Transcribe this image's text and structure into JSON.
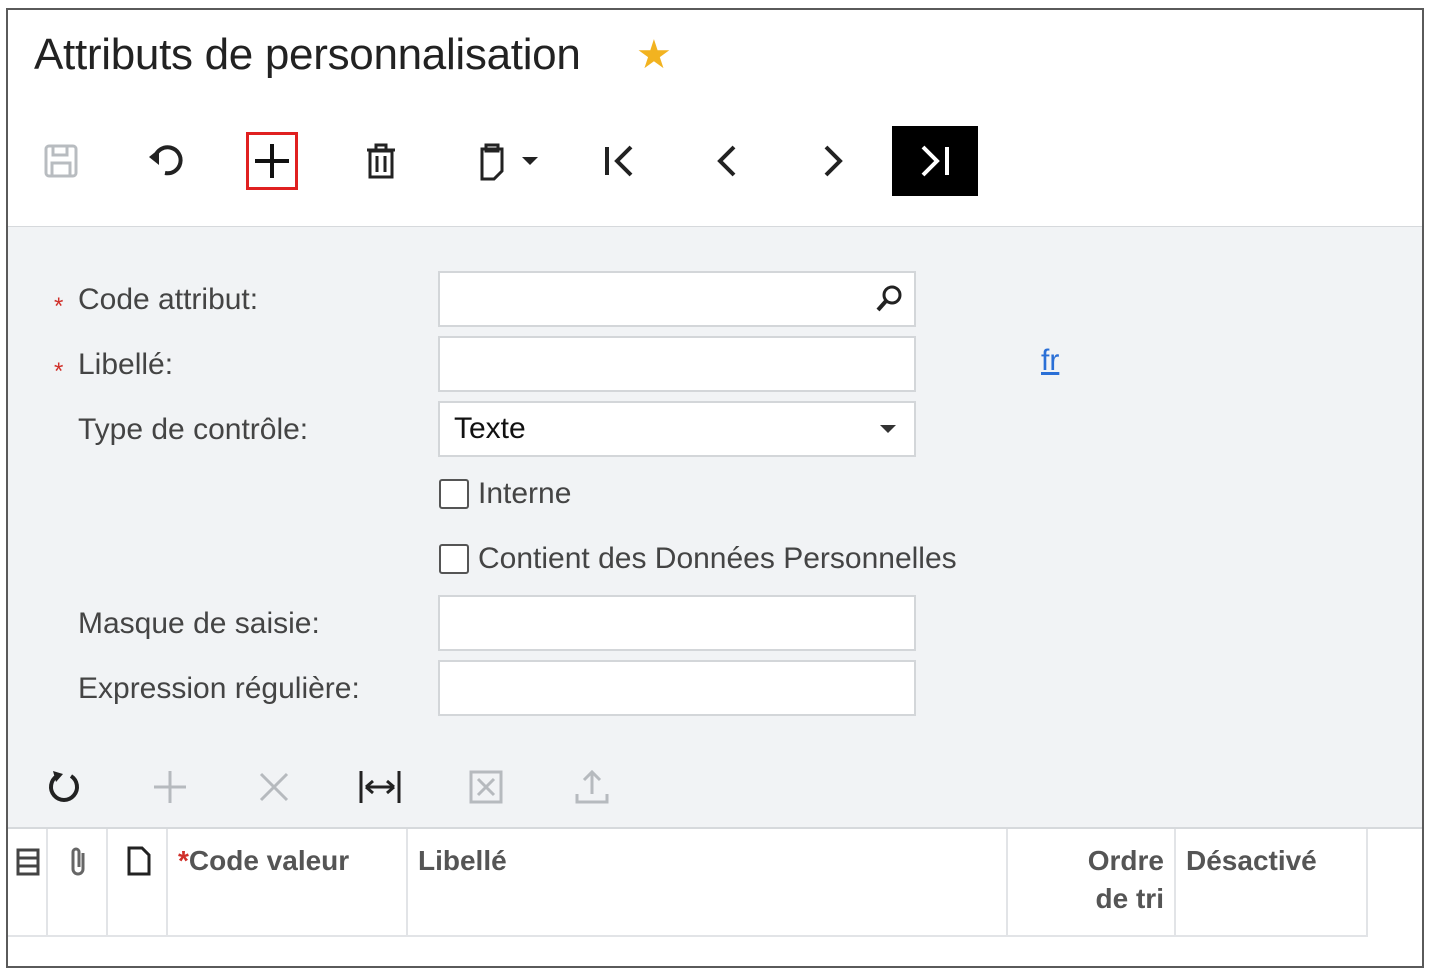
{
  "page": {
    "title": "Attributs de personnalisation"
  },
  "form": {
    "code_attribut_label": "Code attribut:",
    "libelle_label": "Libellé:",
    "type_controle_label": "Type de contrôle:",
    "type_controle_value": "Texte",
    "interne_label": "Interne",
    "donnees_perso_label": "Contient des Données Personnelles",
    "masque_label": "Masque de saisie:",
    "expression_label": "Expression régulière:",
    "lang_link": "fr",
    "required_mark": "*"
  },
  "grid": {
    "columns": {
      "code_valeur": "Code valeur",
      "libelle": "Libellé",
      "ordre_line1": "Ordre",
      "ordre_line2": "de tri",
      "desactive": "Désactivé"
    }
  },
  "colors": {
    "accent_star": "#f2b320",
    "required": "#d0302a",
    "link": "#2a6fd6",
    "highlight": "#e02020"
  }
}
